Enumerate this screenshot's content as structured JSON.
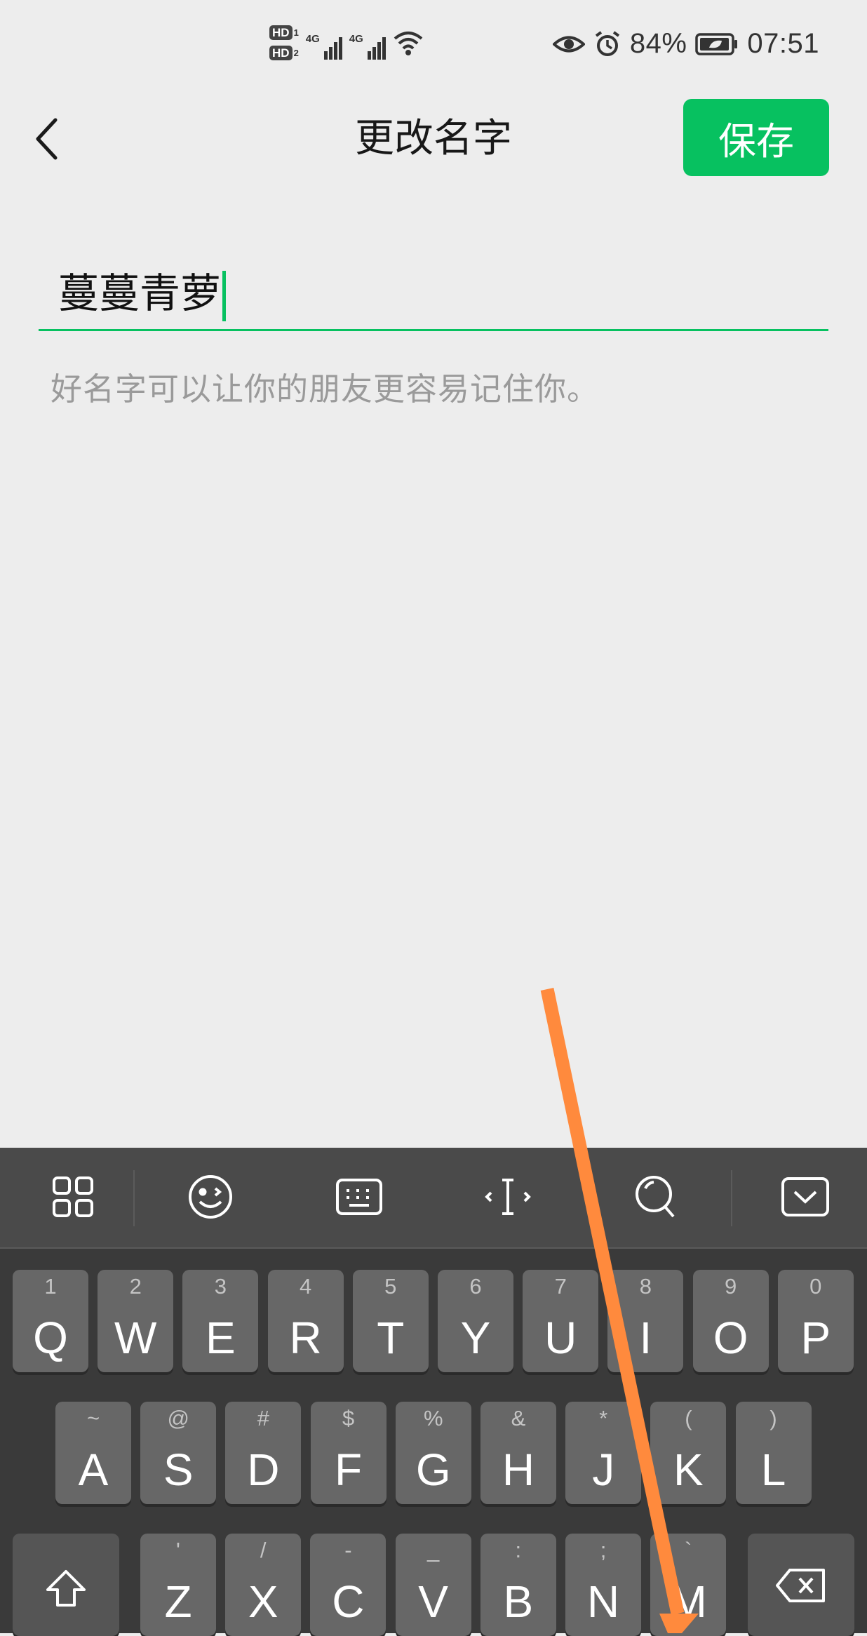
{
  "status_bar": {
    "hd1": "HD",
    "hd1_num": "1",
    "hd2": "HD",
    "hd2_num": "2",
    "net1": "4G",
    "net2": "4G",
    "battery": "84%",
    "time": "07:51"
  },
  "header": {
    "title": "更改名字",
    "save_label": "保存"
  },
  "name_field": {
    "value": "蔓蔓青萝"
  },
  "hint": "好名字可以让你的朋友更容易记住你。",
  "keyboard": {
    "row1": [
      {
        "sub": "1",
        "main": "Q"
      },
      {
        "sub": "2",
        "main": "W"
      },
      {
        "sub": "3",
        "main": "E"
      },
      {
        "sub": "4",
        "main": "R"
      },
      {
        "sub": "5",
        "main": "T"
      },
      {
        "sub": "6",
        "main": "Y"
      },
      {
        "sub": "7",
        "main": "U"
      },
      {
        "sub": "8",
        "main": "I"
      },
      {
        "sub": "9",
        "main": "O"
      },
      {
        "sub": "0",
        "main": "P"
      }
    ],
    "row2": [
      {
        "sub": "~",
        "main": "A"
      },
      {
        "sub": "@",
        "main": "S"
      },
      {
        "sub": "#",
        "main": "D"
      },
      {
        "sub": "$",
        "main": "F"
      },
      {
        "sub": "%",
        "main": "G"
      },
      {
        "sub": "&",
        "main": "H"
      },
      {
        "sub": "*",
        "main": "J"
      },
      {
        "sub": "(",
        "main": "K"
      },
      {
        "sub": ")",
        "main": "L"
      }
    ],
    "row3": [
      {
        "sub": "'",
        "main": "Z"
      },
      {
        "sub": "/",
        "main": "X"
      },
      {
        "sub": "-",
        "main": "C"
      },
      {
        "sub": "_",
        "main": "V"
      },
      {
        "sub": ":",
        "main": "B"
      },
      {
        "sub": ";",
        "main": "N"
      },
      {
        "sub": "`",
        "main": "M"
      }
    ]
  },
  "icons": {
    "status": [
      "hd-icon",
      "signal-icon",
      "wifi-icon",
      "eye-icon",
      "alarm-icon",
      "battery-icon"
    ],
    "toolbar": [
      "grid-icon",
      "emoji-icon",
      "keyboard-icon",
      "cursor-icon",
      "search-icon",
      "hide-keyboard-icon"
    ],
    "keys": [
      "shift-icon",
      "backspace-icon"
    ]
  },
  "colors": {
    "accent": "#07c160",
    "background": "#ededed",
    "keyboard_bg": "#3a3a3a",
    "key_bg": "#676767",
    "annotation_arrow": "#ff8a3d"
  }
}
